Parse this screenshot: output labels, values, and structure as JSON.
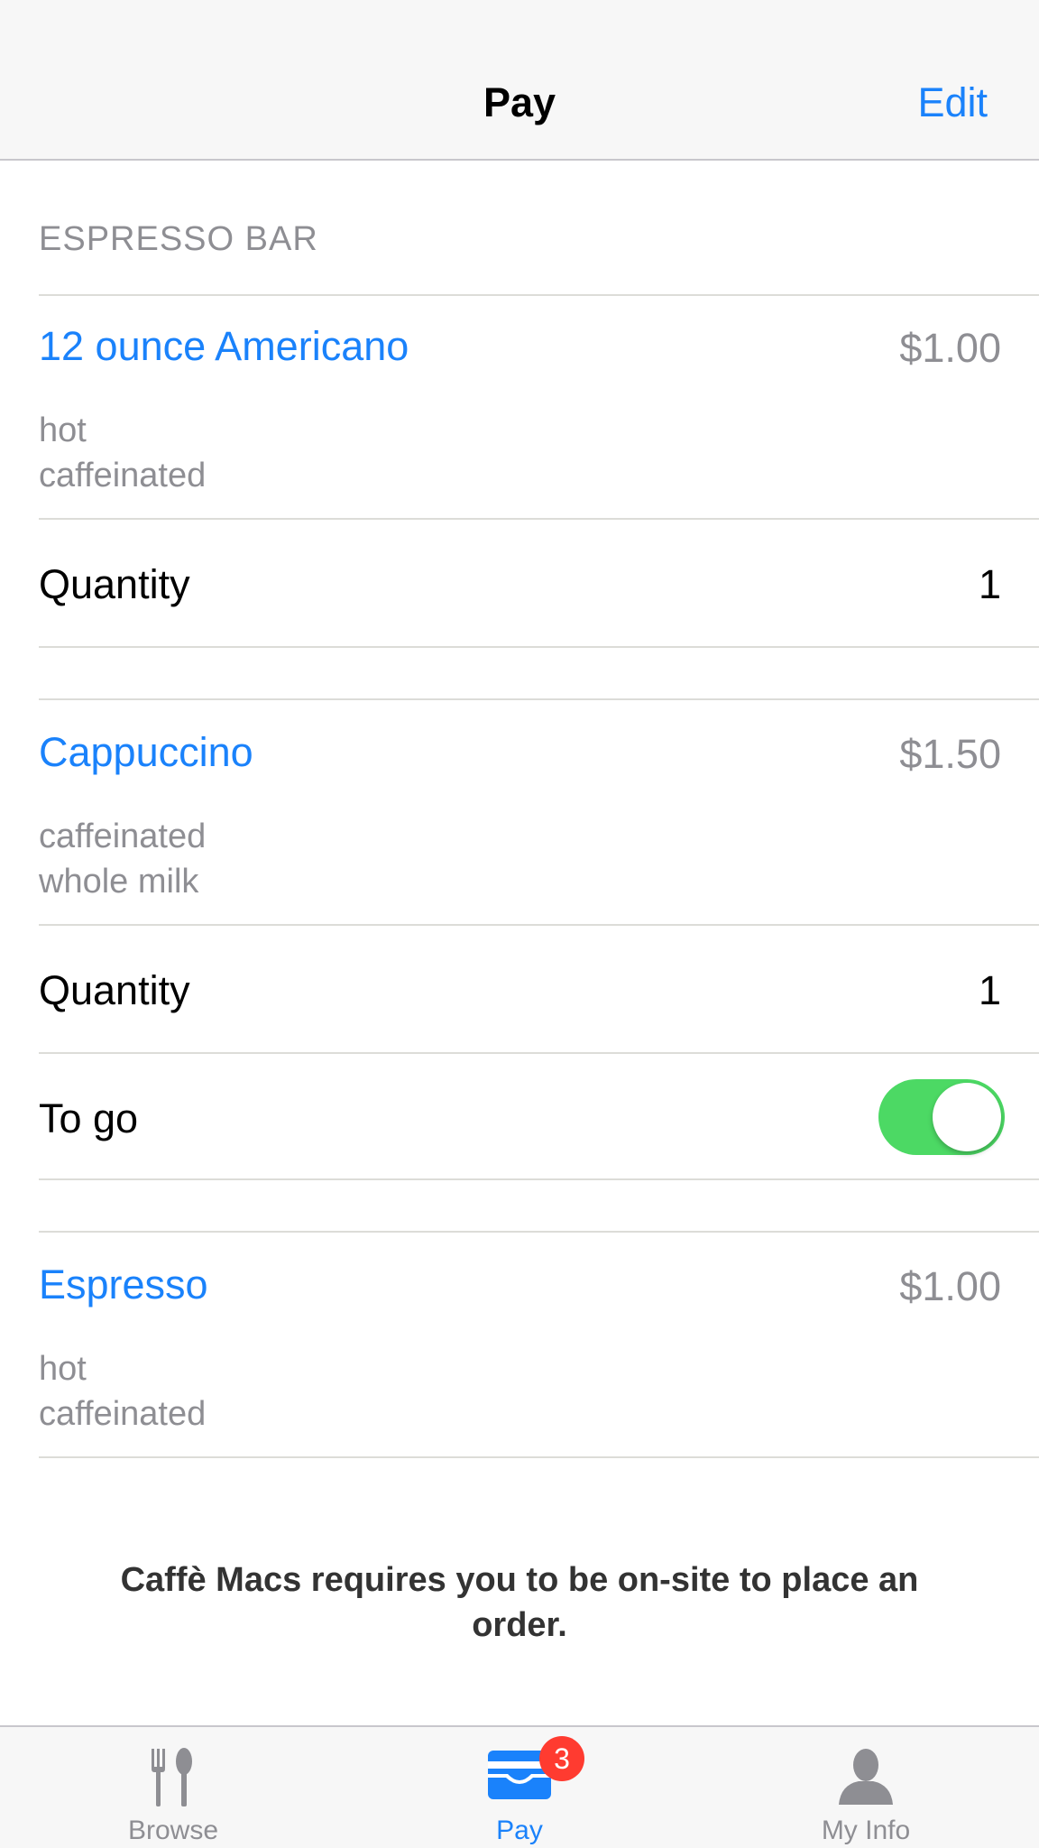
{
  "navbar": {
    "title": "Pay",
    "edit_label": "Edit"
  },
  "section": {
    "header": "ESPRESSO BAR"
  },
  "items": [
    {
      "name": "12 ounce Americano",
      "price": "$1.00",
      "details": [
        "hot",
        "caffeinated"
      ],
      "quantity_label": "Quantity",
      "quantity": "1"
    },
    {
      "name": "Cappuccino",
      "price": "$1.50",
      "details": [
        "caffeinated",
        "whole milk"
      ],
      "quantity_label": "Quantity",
      "quantity": "1",
      "togo_label": "To go",
      "togo_on": true
    },
    {
      "name": "Espresso",
      "price": "$1.00",
      "details": [
        "hot",
        "caffeinated"
      ]
    }
  ],
  "notice": {
    "text": "Caffè Macs requires you to be on-site to place an order."
  },
  "tabbar": {
    "tabs": [
      {
        "label": "Browse",
        "icon": "fork-knife-icon"
      },
      {
        "label": "Pay",
        "icon": "wallet-icon",
        "badge": "3"
      },
      {
        "label": "My Info",
        "icon": "person-icon"
      }
    ]
  },
  "colors": {
    "accent": "#1a82fb",
    "toggle_on": "#4cd964",
    "badge": "#ff3b30",
    "secondary_text": "#8e8e93"
  }
}
